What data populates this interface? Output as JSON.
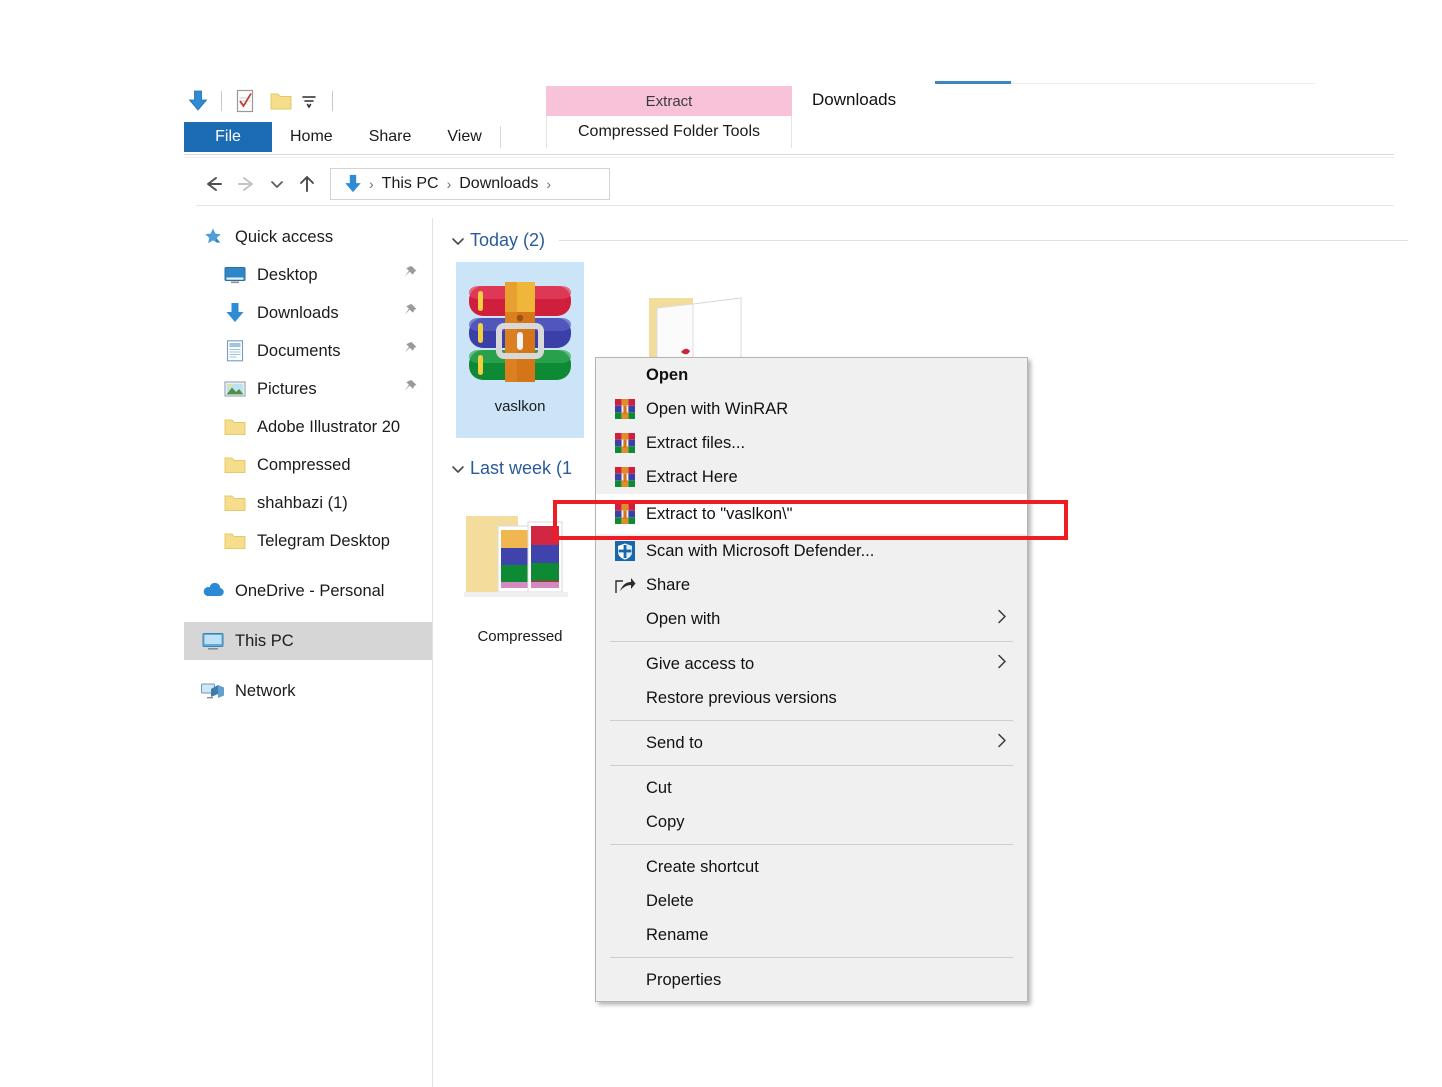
{
  "window": {
    "title": "Downloads",
    "accent_blue": "#1c6cb4",
    "contextual_pink": "#f8c2d8",
    "selection_blue": "#cce4f7"
  },
  "quick_access_toolbar": {
    "items": [
      {
        "name": "downloads-icon",
        "label": "Downloads"
      },
      {
        "name": "properties-icon",
        "label": "Properties"
      },
      {
        "name": "new-folder-icon",
        "label": "New folder"
      },
      {
        "name": "customize-dropdown-icon",
        "label": "Customize Quick Access Toolbar"
      }
    ]
  },
  "ribbon": {
    "tabs": [
      {
        "label": "File",
        "selected": true
      },
      {
        "label": "Home",
        "selected": false
      },
      {
        "label": "Share",
        "selected": false
      },
      {
        "label": "View",
        "selected": false
      }
    ],
    "contextual": {
      "header": "Extract",
      "group_title": "Compressed Folder Tools"
    }
  },
  "addressbar": {
    "back_icon": "arrow-left-icon",
    "forward_icon": "arrow-right-icon",
    "recent_icon": "chevron-down-icon",
    "up_icon": "arrow-up-icon",
    "path_icon": "downloads-icon",
    "crumbs": [
      "This PC",
      "Downloads"
    ],
    "separator": "›"
  },
  "sidebar": {
    "items": [
      {
        "label": "Quick access",
        "icon": "star-pin-icon",
        "indent": 0,
        "pinned": false,
        "selected": false
      },
      {
        "label": "Desktop",
        "icon": "desktop-icon",
        "indent": 1,
        "pinned": true,
        "selected": false
      },
      {
        "label": "Downloads",
        "icon": "downloads-icon",
        "indent": 1,
        "pinned": true,
        "selected": false
      },
      {
        "label": "Documents",
        "icon": "documents-icon",
        "indent": 1,
        "pinned": true,
        "selected": false
      },
      {
        "label": "Pictures",
        "icon": "pictures-icon",
        "indent": 1,
        "pinned": true,
        "selected": false
      },
      {
        "label": "Adobe Illustrator 20",
        "icon": "folder-icon",
        "indent": 1,
        "pinned": false,
        "selected": false
      },
      {
        "label": "Compressed",
        "icon": "folder-icon",
        "indent": 1,
        "pinned": false,
        "selected": false
      },
      {
        "label": "shahbazi (1)",
        "icon": "folder-icon",
        "indent": 1,
        "pinned": false,
        "selected": false
      },
      {
        "label": "Telegram Desktop",
        "icon": "folder-icon",
        "indent": 1,
        "pinned": false,
        "selected": false
      },
      {
        "label": "OneDrive - Personal",
        "icon": "onedrive-cloud-icon",
        "indent": 0,
        "pinned": false,
        "selected": false
      },
      {
        "label": "This PC",
        "icon": "this-pc-icon",
        "indent": 0,
        "pinned": false,
        "selected": true
      },
      {
        "label": "Network",
        "icon": "network-icon",
        "indent": 0,
        "pinned": false,
        "selected": false
      }
    ]
  },
  "content": {
    "groups": [
      {
        "label": "Today (2)"
      },
      {
        "label": "Last week (1"
      }
    ],
    "files": [
      {
        "name": "vaslkon",
        "icon": "winrar-archive-icon",
        "selected": true
      },
      {
        "name": "",
        "icon": "open-folder-icon",
        "selected": false
      },
      {
        "name": "Compressed",
        "icon": "folder-with-thumbnail-icon",
        "selected": false
      }
    ]
  },
  "context_menu": {
    "items": [
      {
        "label": "Open",
        "icon": null,
        "bold": true,
        "submenu": false,
        "highlight": false
      },
      {
        "label": "Open with WinRAR",
        "icon": "winrar-icon",
        "bold": false,
        "submenu": false,
        "highlight": false
      },
      {
        "label": "Extract files...",
        "icon": "winrar-icon",
        "bold": false,
        "submenu": false,
        "highlight": false
      },
      {
        "label": "Extract Here",
        "icon": "winrar-icon",
        "bold": false,
        "submenu": false,
        "highlight": false
      },
      {
        "label": "Extract to \"vaslkon\\\"",
        "icon": "winrar-icon",
        "bold": false,
        "submenu": false,
        "highlight": true
      },
      {
        "label": "Scan with Microsoft Defender...",
        "icon": "defender-shield-icon",
        "bold": false,
        "submenu": false,
        "highlight": false
      },
      {
        "label": "Share",
        "icon": "share-icon",
        "bold": false,
        "submenu": false,
        "highlight": false
      },
      {
        "label": "Open with",
        "icon": null,
        "bold": false,
        "submenu": true,
        "highlight": false
      },
      {
        "separator": true
      },
      {
        "label": "Give access to",
        "icon": null,
        "bold": false,
        "submenu": true,
        "highlight": false
      },
      {
        "label": "Restore previous versions",
        "icon": null,
        "bold": false,
        "submenu": false,
        "highlight": false
      },
      {
        "separator": true
      },
      {
        "label": "Send to",
        "icon": null,
        "bold": false,
        "submenu": true,
        "highlight": false
      },
      {
        "separator": true
      },
      {
        "label": "Cut",
        "icon": null,
        "bold": false,
        "submenu": false,
        "highlight": false
      },
      {
        "label": "Copy",
        "icon": null,
        "bold": false,
        "submenu": false,
        "highlight": false
      },
      {
        "separator": true
      },
      {
        "label": "Create shortcut",
        "icon": null,
        "bold": false,
        "submenu": false,
        "highlight": false
      },
      {
        "label": "Delete",
        "icon": null,
        "bold": false,
        "submenu": false,
        "highlight": false
      },
      {
        "label": "Rename",
        "icon": null,
        "bold": false,
        "submenu": false,
        "highlight": false
      },
      {
        "separator": true
      },
      {
        "label": "Properties",
        "icon": null,
        "bold": false,
        "submenu": false,
        "highlight": false
      }
    ]
  },
  "annotation": {
    "highlight_color": "#ee1c25",
    "target_label": "Extract to \"vaslkon\\\""
  }
}
